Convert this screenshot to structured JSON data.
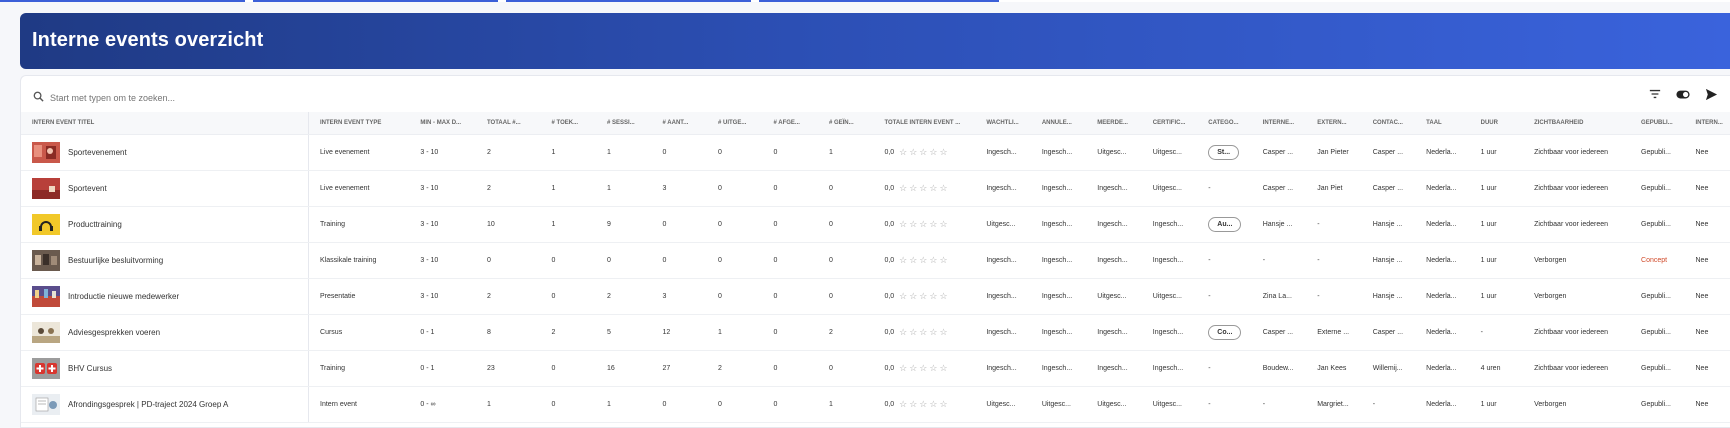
{
  "page": {
    "title": "Interne events overzicht",
    "accent": "#2c4fb4"
  },
  "search": {
    "placeholder": "Start met typen om te zoeken...",
    "icon": "search-icon"
  },
  "toolbar": {
    "icons": [
      "filter-icon",
      "toggle-icon",
      "send-icon"
    ]
  },
  "table": {
    "columns": [
      "INTERN EVENT TITEL",
      "INTERN EVENT TYPE",
      "MIN - MAX D...",
      "TOTAAL #...",
      "# TOEK...",
      "# SESSI...",
      "# AANT...",
      "# UITGE...",
      "# AFGE...",
      "# GEÏN...",
      "TOTALE INTERN EVENT ...",
      "WACHTLI...",
      "ANNULE...",
      "MEERDE...",
      "CERTIFIC...",
      "CATEGO...",
      "INTERNE...",
      "EXTERN...",
      "CONTAC...",
      "TAAL",
      "DUUR",
      "ZICHTBAARHEID",
      "GEPUBLI...",
      "INTERN..."
    ],
    "rows": [
      {
        "title": "Sportevenement",
        "type": "Live evenement",
        "minmax": "3 - 10",
        "totaal": "2",
        "toek": "1",
        "sessi": "1",
        "aant": "0",
        "uitge": "0",
        "afge": "0",
        "gein": "1",
        "rating": "0,0",
        "stars": "☆☆☆☆☆",
        "wacht": "Ingesch...",
        "annul": "Ingesch...",
        "meerd": "Uitgesc...",
        "certif": "Uitgesc...",
        "categ": "St...",
        "categPill": true,
        "intern": "Casper ...",
        "extern": "Jan Pieter",
        "contact": "Casper ...",
        "taal": "Nederla...",
        "duur": "1 uur",
        "zicht": "Zichtbaar voor iedereen",
        "gepub": "Gepubli...",
        "gepubConcept": false,
        "internFlag": "Nee",
        "thumb": "sport1"
      },
      {
        "title": "Sportevent",
        "type": "Live evenement",
        "minmax": "3 - 10",
        "totaal": "2",
        "toek": "1",
        "sessi": "1",
        "aant": "3",
        "uitge": "0",
        "afge": "0",
        "gein": "0",
        "rating": "0,0",
        "stars": "☆☆☆☆☆",
        "wacht": "Ingesch...",
        "annul": "Ingesch...",
        "meerd": "Ingesch...",
        "certif": "Uitgesc...",
        "categ": "-",
        "categPill": false,
        "intern": "Casper ...",
        "extern": "Jan Piet",
        "contact": "Casper ...",
        "taal": "Nederla...",
        "duur": "1 uur",
        "zicht": "Zichtbaar voor iedereen",
        "gepub": "Gepubli...",
        "gepubConcept": false,
        "internFlag": "Nee",
        "thumb": "sport2"
      },
      {
        "title": "Producttraining",
        "type": "Training",
        "minmax": "3 - 10",
        "totaal": "10",
        "toek": "1",
        "sessi": "9",
        "aant": "0",
        "uitge": "0",
        "afge": "0",
        "gein": "0",
        "rating": "0,0",
        "stars": "☆☆☆☆☆",
        "wacht": "Uitgesc...",
        "annul": "Ingesch...",
        "meerd": "Ingesch...",
        "certif": "Ingesch...",
        "categ": "Au...",
        "categPill": true,
        "intern": "Hansje ...",
        "extern": "-",
        "contact": "Hansje ...",
        "taal": "Nederla...",
        "duur": "1 uur",
        "zicht": "Zichtbaar voor iedereen",
        "gepub": "Gepubli...",
        "gepubConcept": false,
        "internFlag": "Nee",
        "thumb": "product"
      },
      {
        "title": "Bestuurlijke besluitvorming",
        "type": "Klassikale training",
        "minmax": "3 - 10",
        "totaal": "0",
        "toek": "0",
        "sessi": "0",
        "aant": "0",
        "uitge": "0",
        "afge": "0",
        "gein": "0",
        "rating": "0,0",
        "stars": "☆☆☆☆☆",
        "wacht": "Ingesch...",
        "annul": "Ingesch...",
        "meerd": "Ingesch...",
        "certif": "Ingesch...",
        "categ": "-",
        "categPill": false,
        "intern": "-",
        "extern": "-",
        "contact": "Hansje ...",
        "taal": "Nederla...",
        "duur": "1 uur",
        "zicht": "Verborgen",
        "gepub": "Concept",
        "gepubConcept": true,
        "internFlag": "Nee",
        "thumb": "bestuur"
      },
      {
        "title": "Introductie nieuwe medewerker",
        "type": "Presentatie",
        "minmax": "3 - 10",
        "totaal": "2",
        "toek": "0",
        "sessi": "2",
        "aant": "3",
        "uitge": "0",
        "afge": "0",
        "gein": "0",
        "rating": "0,0",
        "stars": "☆☆☆☆☆",
        "wacht": "Ingesch...",
        "annul": "Ingesch...",
        "meerd": "Uitgesc...",
        "certif": "Uitgesc...",
        "categ": "-",
        "categPill": false,
        "intern": "Zina La...",
        "extern": "-",
        "contact": "Hansje ...",
        "taal": "Nederla...",
        "duur": "1 uur",
        "zicht": "Verborgen",
        "gepub": "Gepubli...",
        "gepubConcept": false,
        "internFlag": "Nee",
        "thumb": "intro"
      },
      {
        "title": "Adviesgesprekken voeren",
        "type": "Cursus",
        "minmax": "0 - 1",
        "totaal": "8",
        "toek": "2",
        "sessi": "5",
        "aant": "12",
        "uitge": "1",
        "afge": "0",
        "gein": "2",
        "rating": "0,0",
        "stars": "☆☆☆☆☆",
        "wacht": "Ingesch...",
        "annul": "Ingesch...",
        "meerd": "Ingesch...",
        "certif": "Ingesch...",
        "categ": "Co...",
        "categPill": true,
        "intern": "Casper ...",
        "extern": "Externe ...",
        "contact": "Casper ...",
        "taal": "Nederla...",
        "duur": "-",
        "zicht": "Zichtbaar voor iedereen",
        "gepub": "Gepubli...",
        "gepubConcept": false,
        "internFlag": "Nee",
        "thumb": "advies"
      },
      {
        "title": "BHV Cursus",
        "type": "Training",
        "minmax": "0 - 1",
        "totaal": "23",
        "toek": "0",
        "sessi": "16",
        "aant": "27",
        "uitge": "2",
        "afge": "0",
        "gein": "0",
        "rating": "0,0",
        "stars": "☆☆☆☆☆",
        "wacht": "Ingesch...",
        "annul": "Ingesch...",
        "meerd": "Ingesch...",
        "certif": "Ingesch...",
        "categ": "-",
        "categPill": false,
        "intern": "Boudew...",
        "extern": "Jan Kees",
        "contact": "Willemij...",
        "taal": "Nederla...",
        "duur": "4 uren",
        "zicht": "Zichtbaar voor iedereen",
        "gepub": "Gepubli...",
        "gepubConcept": false,
        "internFlag": "Nee",
        "thumb": "bhv"
      },
      {
        "title": "Afrondingsgesprek | PD-traject 2024 Groep A",
        "type": "Intern event",
        "minmax": "0 - ∞",
        "totaal": "1",
        "toek": "0",
        "sessi": "1",
        "aant": "0",
        "uitge": "0",
        "afge": "0",
        "gein": "1",
        "rating": "0,0",
        "stars": "☆☆☆☆☆",
        "wacht": "Uitgesc...",
        "annul": "Uitgesc...",
        "meerd": "Uitgesc...",
        "certif": "Uitgesc...",
        "categ": "-",
        "categPill": false,
        "intern": "-",
        "extern": "Margriet...",
        "contact": "-",
        "taal": "Nederla...",
        "duur": "1 uur",
        "zicht": "Verborgen",
        "gepub": "Gepubli...",
        "gepubConcept": false,
        "internFlag": "Nee",
        "thumb": "afronding"
      }
    ]
  }
}
